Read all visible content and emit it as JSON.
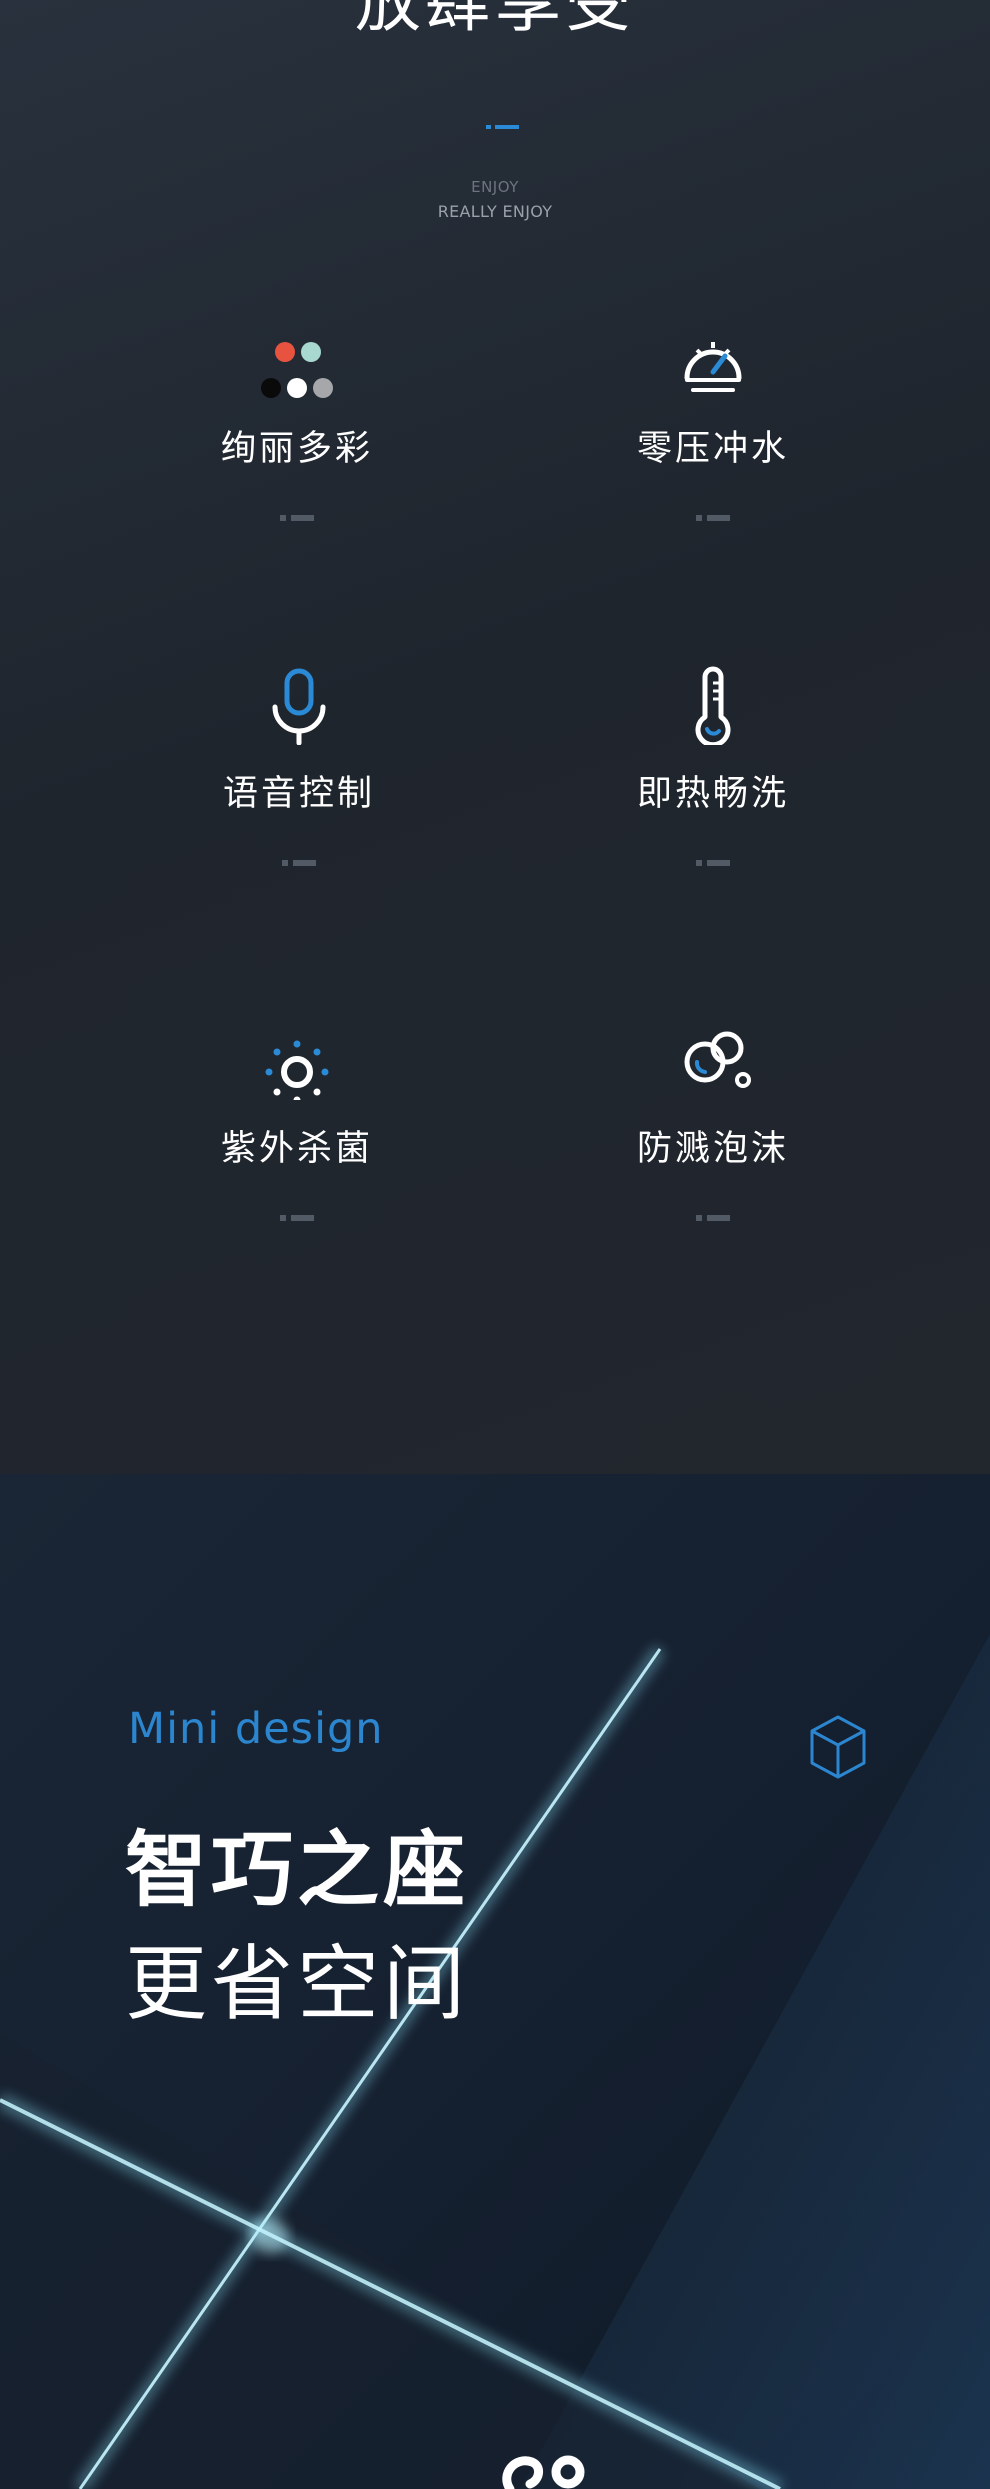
{
  "header": {
    "title": "放肆享受",
    "subtitle_line1": "ENJOY",
    "subtitle_line2": "REALLY ENJOY"
  },
  "features": [
    {
      "label": "绚丽多彩",
      "icon": "colors-dots-icon"
    },
    {
      "label": "零压冲水",
      "icon": "pressure-gauge-icon"
    },
    {
      "label": "语音控制",
      "icon": "microphone-icon"
    },
    {
      "label": "即热畅洗",
      "icon": "thermometer-icon"
    },
    {
      "label": "紫外杀菌",
      "icon": "uv-sun-icon"
    },
    {
      "label": "防溅泡沫",
      "icon": "foam-bubbles-icon"
    }
  ],
  "colors": {
    "accent_blue": "#2b8ad6",
    "dot_red": "#e8533f",
    "dot_mint": "#a8d8d0",
    "dot_black": "#0a0a0a",
    "dot_white": "#ffffff",
    "dot_gray": "#a5a7ab",
    "light_beam": "#8fe9ff"
  },
  "mini_section": {
    "tag": "Mini design",
    "headline_bold": "智巧之座",
    "headline_regular": "更省空间",
    "icon": "cube-icon"
  }
}
